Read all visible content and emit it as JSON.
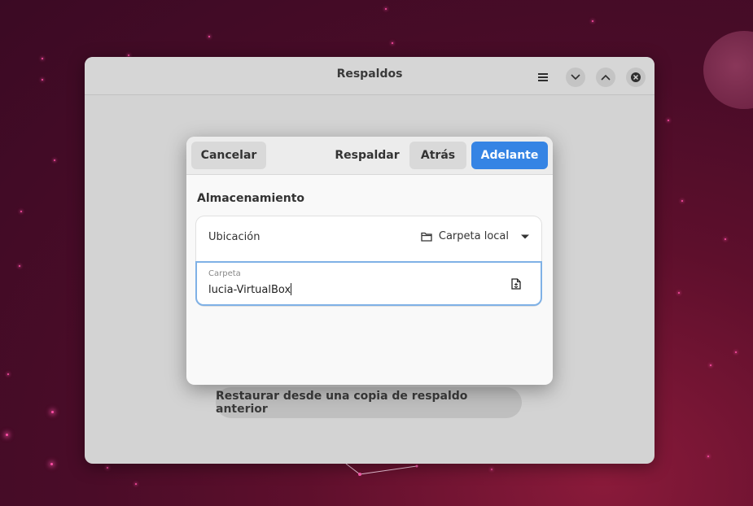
{
  "window": {
    "title": "Respaldos",
    "menu_icon": "hamburger-menu-icon",
    "minimize_icon": "chevron-down-icon",
    "maximize_icon": "chevron-up-icon",
    "close_icon": "close-icon",
    "restore_label": "Restaurar desde una copia de respaldo anterior"
  },
  "dialog": {
    "cancel_label": "Cancelar",
    "backup_label": "Respaldar",
    "back_label": "Atrás",
    "forward_label": "Adelante",
    "section_title": "Almacenamiento",
    "location": {
      "label": "Ubicación",
      "value": "Carpeta local",
      "icon": "folder-icon",
      "dropdown_icon": "dropdown-arrow-icon"
    },
    "folder": {
      "caption": "Carpeta",
      "value": "lucia-VirtualBox",
      "icon": "choose-folder-icon"
    }
  },
  "colors": {
    "accent": "#3584e4",
    "focus_border": "#7fb1e6",
    "desktop_base": "#4a0c28"
  }
}
